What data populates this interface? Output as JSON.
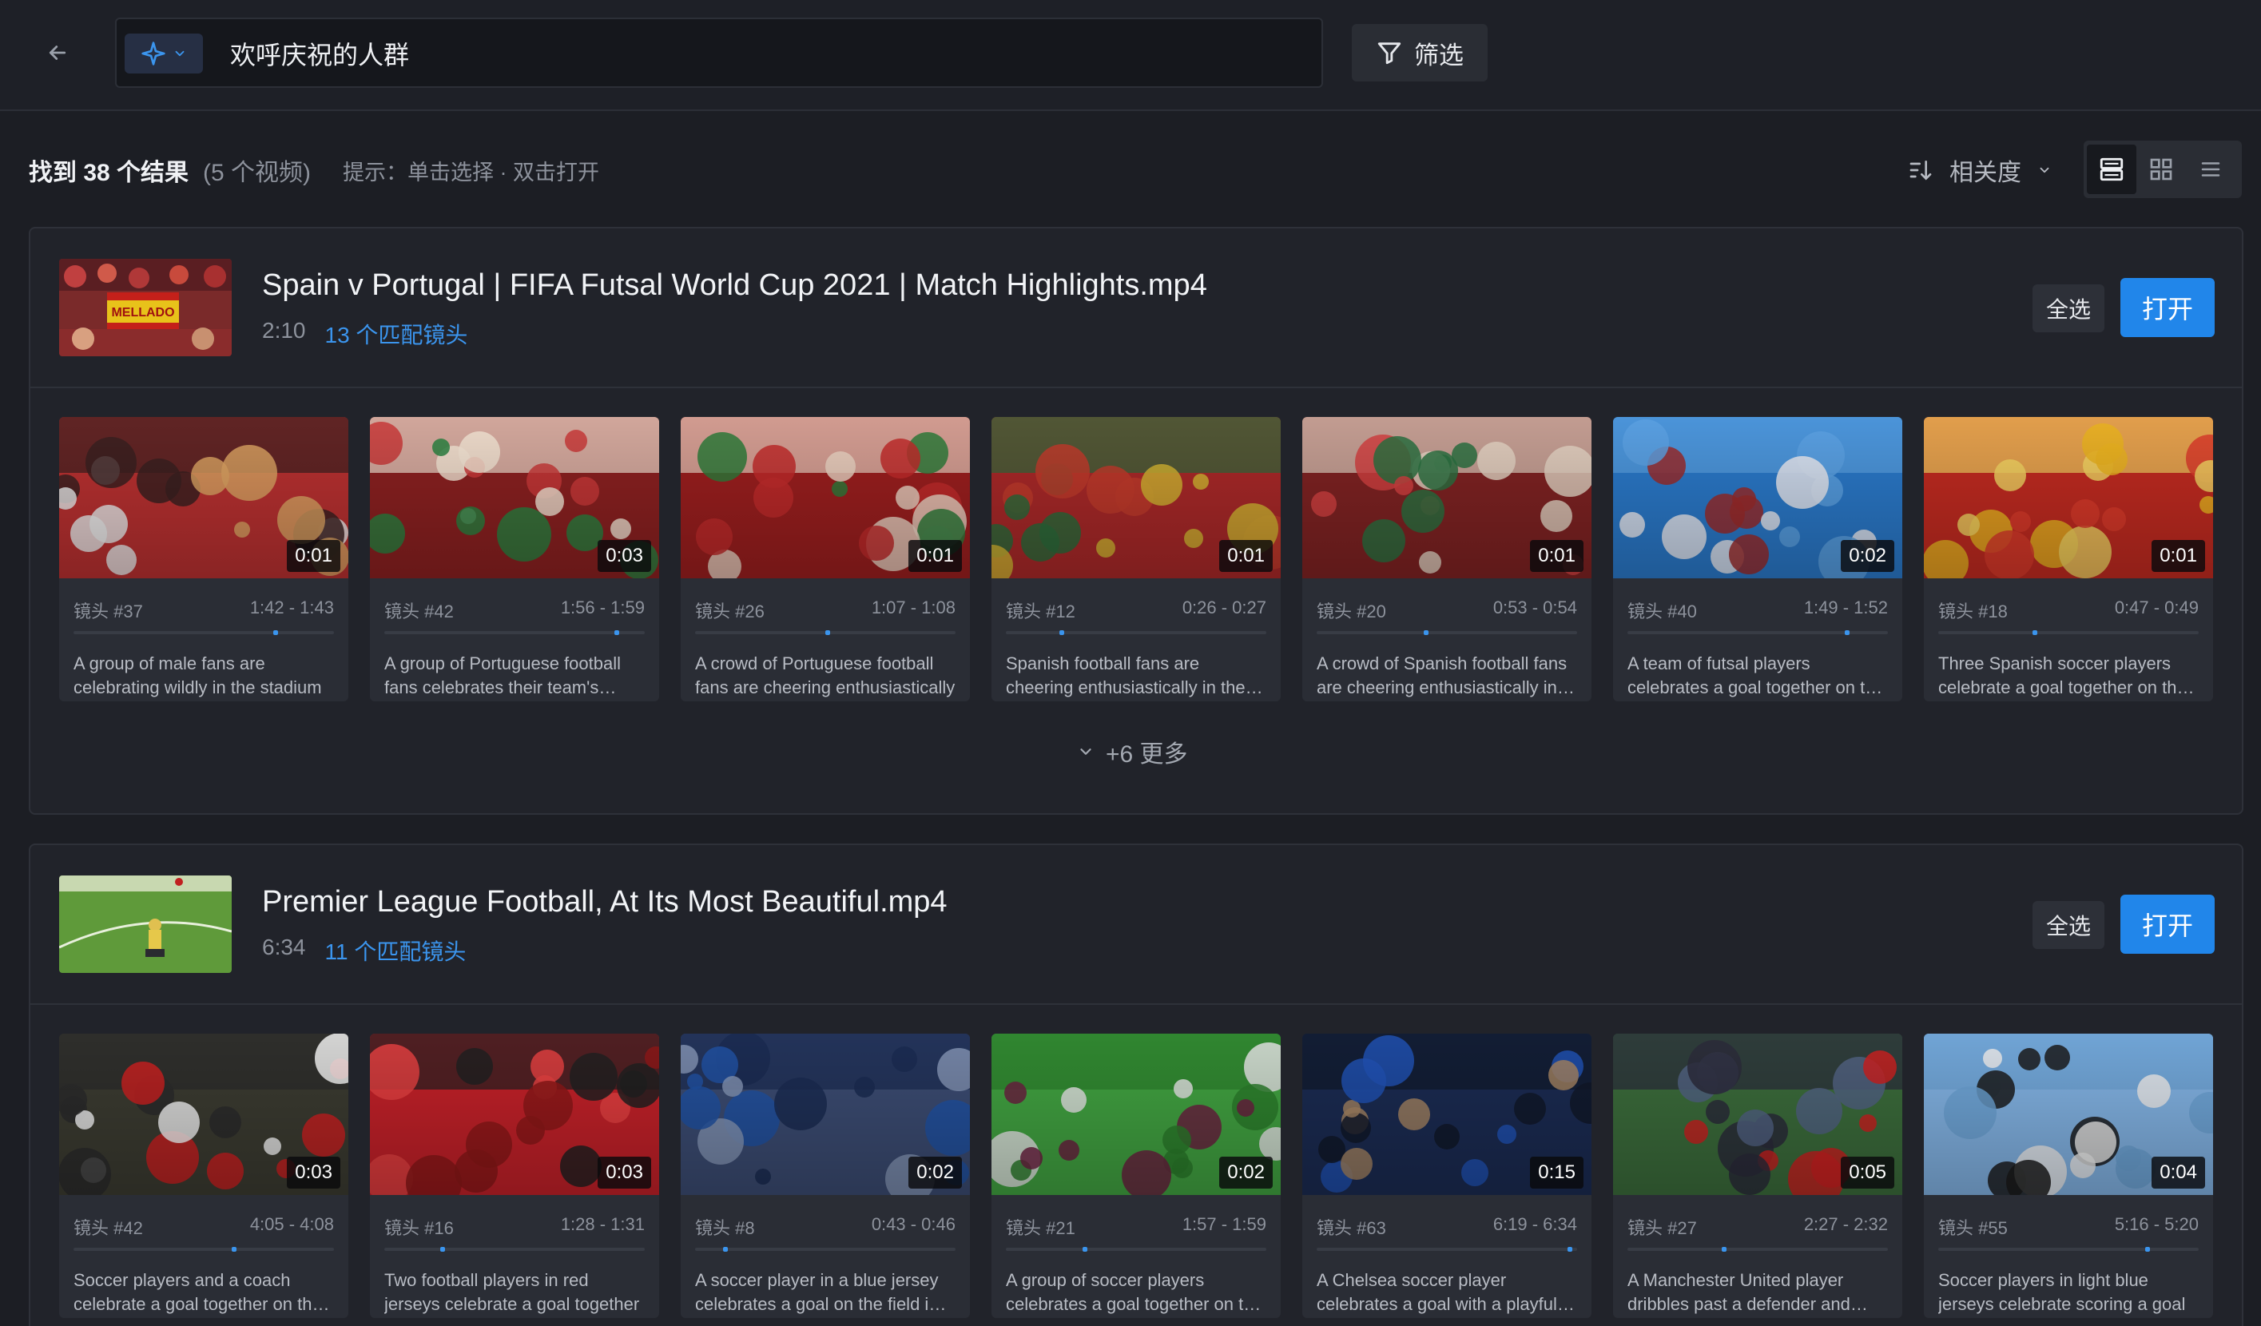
{
  "search": {
    "query": "欢呼庆祝的人群",
    "filter_label": "筛选"
  },
  "results": {
    "found": "找到 38 个结果",
    "videos": "(5 个视频)",
    "hint": "提示：单击选择 · 双击打开",
    "sort_label": "相关度"
  },
  "groups": [
    {
      "title": "Spain v Portugal | FIFA Futsal World Cup 2021 | Match Highlights.mp4",
      "duration": "2:10",
      "matches": "13 个匹配镜头",
      "select_all": "全选",
      "open": "打开",
      "more": "+6 更多",
      "shots": [
        {
          "shot": "镜头 #37",
          "range": "1:42 - 1:43",
          "dur": "0:01",
          "progress": 0.78,
          "desc": "A group of male fans are celebrating wildly in the stadium"
        },
        {
          "shot": "镜头 #42",
          "range": "1:56 - 1:59",
          "dur": "0:03",
          "progress": 0.9,
          "desc": "A group of Portuguese football fans celebrates their team's victory"
        },
        {
          "shot": "镜头 #26",
          "range": "1:07 - 1:08",
          "dur": "0:01",
          "progress": 0.51,
          "desc": "A crowd of Portuguese football fans are cheering enthusiastically"
        },
        {
          "shot": "镜头 #12",
          "range": "0:26 - 0:27",
          "dur": "0:01",
          "progress": 0.21,
          "desc": "Spanish football fans are cheering enthusiastically in the stands"
        },
        {
          "shot": "镜头 #20",
          "range": "0:53 - 0:54",
          "dur": "0:01",
          "progress": 0.42,
          "desc": "A crowd of Spanish football fans are cheering enthusiastically in the stadium"
        },
        {
          "shot": "镜头 #40",
          "range": "1:49 - 1:52",
          "dur": "0:02",
          "progress": 0.85,
          "desc": "A team of futsal players celebrates a goal together on the court"
        },
        {
          "shot": "镜头 #18",
          "range": "0:47 - 0:49",
          "dur": "0:01",
          "progress": 0.37,
          "desc": "Three Spanish soccer players celebrate a goal together on the court"
        }
      ]
    },
    {
      "title": "Premier League Football, At Its Most Beautiful.mp4",
      "duration": "6:34",
      "matches": "11 个匹配镜头",
      "select_all": "全选",
      "open": "打开",
      "shots": [
        {
          "shot": "镜头 #42",
          "range": "4:05 - 4:08",
          "dur": "0:03",
          "progress": 0.62,
          "desc": "Soccer players and a coach celebrate a goal together on the pitch"
        },
        {
          "shot": "镜头 #16",
          "range": "1:28 - 1:31",
          "dur": "0:03",
          "progress": 0.22,
          "desc": "Two football players in red jerseys celebrate a goal together"
        },
        {
          "shot": "镜头 #8",
          "range": "0:43 - 0:46",
          "dur": "0:02",
          "progress": 0.11,
          "desc": "A soccer player in a blue jersey celebrates a goal on the field in front of fans"
        },
        {
          "shot": "镜头 #21",
          "range": "1:57 - 1:59",
          "dur": "0:02",
          "progress": 0.3,
          "desc": "A group of soccer players celebrates a goal together on the pitch"
        },
        {
          "shot": "镜头 #63",
          "range": "6:19 - 6:34",
          "dur": "0:15",
          "progress": 0.98,
          "desc": "A Chelsea soccer player celebrates a goal with a playful gesture"
        },
        {
          "shot": "镜头 #27",
          "range": "2:27 - 2:32",
          "dur": "0:05",
          "progress": 0.37,
          "desc": "A Manchester United player dribbles past a defender and scores"
        },
        {
          "shot": "镜头 #55",
          "range": "5:16 - 5:20",
          "dur": "0:04",
          "progress": 0.81,
          "desc": "Soccer players in light blue jerseys celebrate scoring a goal"
        }
      ]
    }
  ]
}
